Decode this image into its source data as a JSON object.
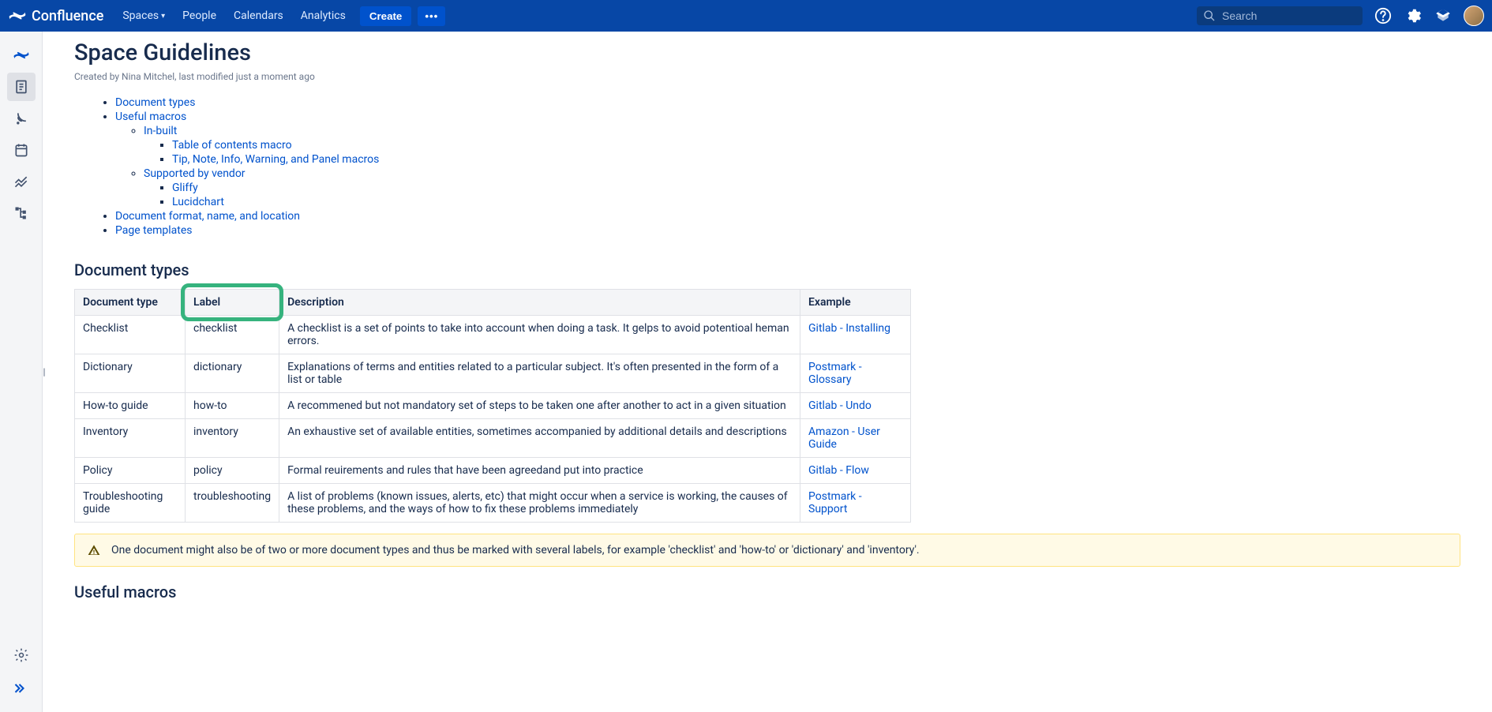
{
  "nav": {
    "product": "Confluence",
    "links": [
      "Spaces",
      "People",
      "Calendars",
      "Analytics"
    ],
    "create": "Create",
    "more": "•••",
    "search_placeholder": "Search"
  },
  "page": {
    "title": "Space Guidelines",
    "byline": "Created by Nina Mitchel, last modified just a moment ago"
  },
  "toc": {
    "items": [
      "Document types",
      "Useful macros",
      "In-built",
      "Table of contents macro",
      "Tip, Note, Info, Warning, and Panel macros",
      "Supported by vendor",
      "Gliffy",
      "Lucidchart",
      "Document format, name, and location",
      "Page templates"
    ]
  },
  "doctypes": {
    "heading": "Document types",
    "headers": {
      "type": "Document type",
      "label": "Label",
      "desc": "Description",
      "example": "Example"
    },
    "rows": [
      {
        "type": "Checklist",
        "label": "checklist",
        "desc": "A checklist is a set of points to take into account when doing a task. It gelps to avoid potentioal heman errors.",
        "example": "Gitlab - Installing"
      },
      {
        "type": "Dictionary",
        "label": "dictionary",
        "desc": "Explanations of terms and entities related to a particular subject. It's often presented in the form of a list or table",
        "example": "Postmark - Glossary"
      },
      {
        "type": "How-to guide",
        "label": "how-to",
        "desc": "A recommened but not mandatory set of steps to be taken one after another to act in a given situation",
        "example": "Gitlab - Undo"
      },
      {
        "type": "Inventory",
        "label": "inventory",
        "desc": "An exhaustive set of available entities, sometimes accompanied by additional details and descriptions",
        "example": "Amazon - User Guide"
      },
      {
        "type": "Policy",
        "label": "policy",
        "desc": "Formal reuirements and rules that have been agreedand put into practice",
        "example": "Gitlab - Flow"
      },
      {
        "type": "Troubleshooting guide",
        "label": "troubleshooting",
        "desc": "A list of problems (known issues, alerts, etc) that might occur when a service is working, the causes of these problems, and the ways of how to fix these problems immediately",
        "example": "Postmark - Support"
      }
    ]
  },
  "note": "One document might also be of two or more document types and thus be marked with several labels, for example 'checklist' and 'how-to' or 'dictionary' and 'inventory'.",
  "macros": {
    "heading": "Useful macros"
  }
}
